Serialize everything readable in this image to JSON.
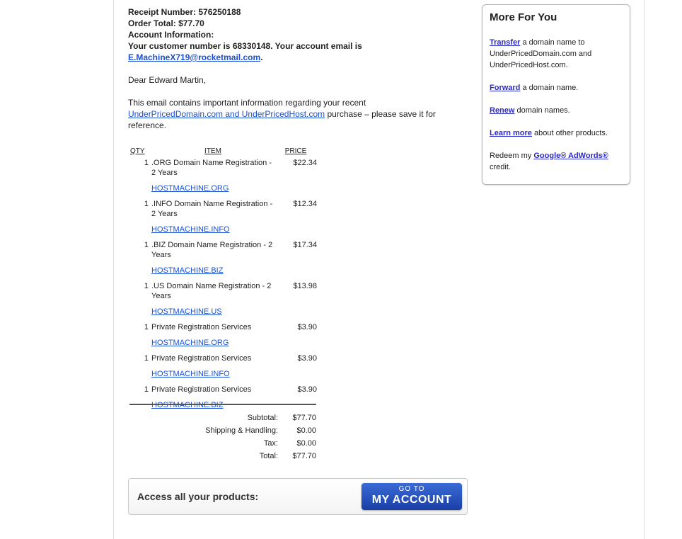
{
  "receipt": {
    "receipt_label": "Receipt Number:",
    "receipt_number": "576250188",
    "order_total_label": "Order Total:",
    "order_total": "$77.70",
    "account_info_label": "Account Information:",
    "customer_text_1": "Your customer number is",
    "customer_number": "68330148",
    "customer_text_2": ". Your account email is",
    "email": "E.MachineX719@rocketmail.com",
    "email_period": "."
  },
  "greeting": "Dear Edward Martin,",
  "intro": {
    "text_1": "This email contains important information regarding your recent",
    "link": "UnderPricedDomain.com and UnderPricedHost.com",
    "text_2": "purchase – please save it for reference."
  },
  "table_headers": {
    "qty": "QTY",
    "item": "ITEM",
    "price": "PRICE"
  },
  "items": [
    {
      "qty": "1",
      "desc": ".ORG Domain Name Registration - 2 Years",
      "price": "$22.34",
      "domain": "HOSTMACHINE.ORG"
    },
    {
      "qty": "1",
      "desc": ".INFO Domain Name Registration - 2 Years",
      "price": "$12.34",
      "domain": "HOSTMACHINE.INFO"
    },
    {
      "qty": "1",
      "desc": ".BIZ Domain Name Registration - 2 Years",
      "price": "$17.34",
      "domain": "HOSTMACHINE.BIZ"
    },
    {
      "qty": "1",
      "desc": ".US Domain Name Registration - 2 Years",
      "price": "$13.98",
      "domain": "HOSTMACHINE.US"
    },
    {
      "qty": "1",
      "desc": "Private Registration Services",
      "price": "$3.90",
      "domain": "HOSTMACHINE.ORG"
    },
    {
      "qty": "1",
      "desc": "Private Registration Services",
      "price": "$3.90",
      "domain": "HOSTMACHINE.INFO"
    },
    {
      "qty": "1",
      "desc": "Private Registration Services",
      "price": "$3.90",
      "domain": "HOSTMACHINE.BIZ"
    }
  ],
  "totals": [
    {
      "label": "Subtotal:",
      "value": "$77.70"
    },
    {
      "label": "Shipping & Handling:",
      "value": "$0.00"
    },
    {
      "label": "Tax:",
      "value": "$0.00"
    },
    {
      "label": "Total:",
      "value": "$77.70"
    }
  ],
  "access": {
    "label": "Access all your products:",
    "button_top": "GO TO",
    "button_main": "MY ACCOUNT"
  },
  "sidebar": {
    "title": "More For You",
    "transfer_link": "Transfer",
    "transfer_text": "a domain name to UnderPricedDomain.com and UnderPricedHost.com.",
    "forward_link": "Forward",
    "forward_text": "a domain name.",
    "renew_link": "Renew",
    "renew_text": "domain names.",
    "learn_link": "Learn more",
    "learn_text": "about other products.",
    "redeem_text": "Redeem my",
    "adwords_link": "Google® AdWords®",
    "credit_text": "credit."
  }
}
